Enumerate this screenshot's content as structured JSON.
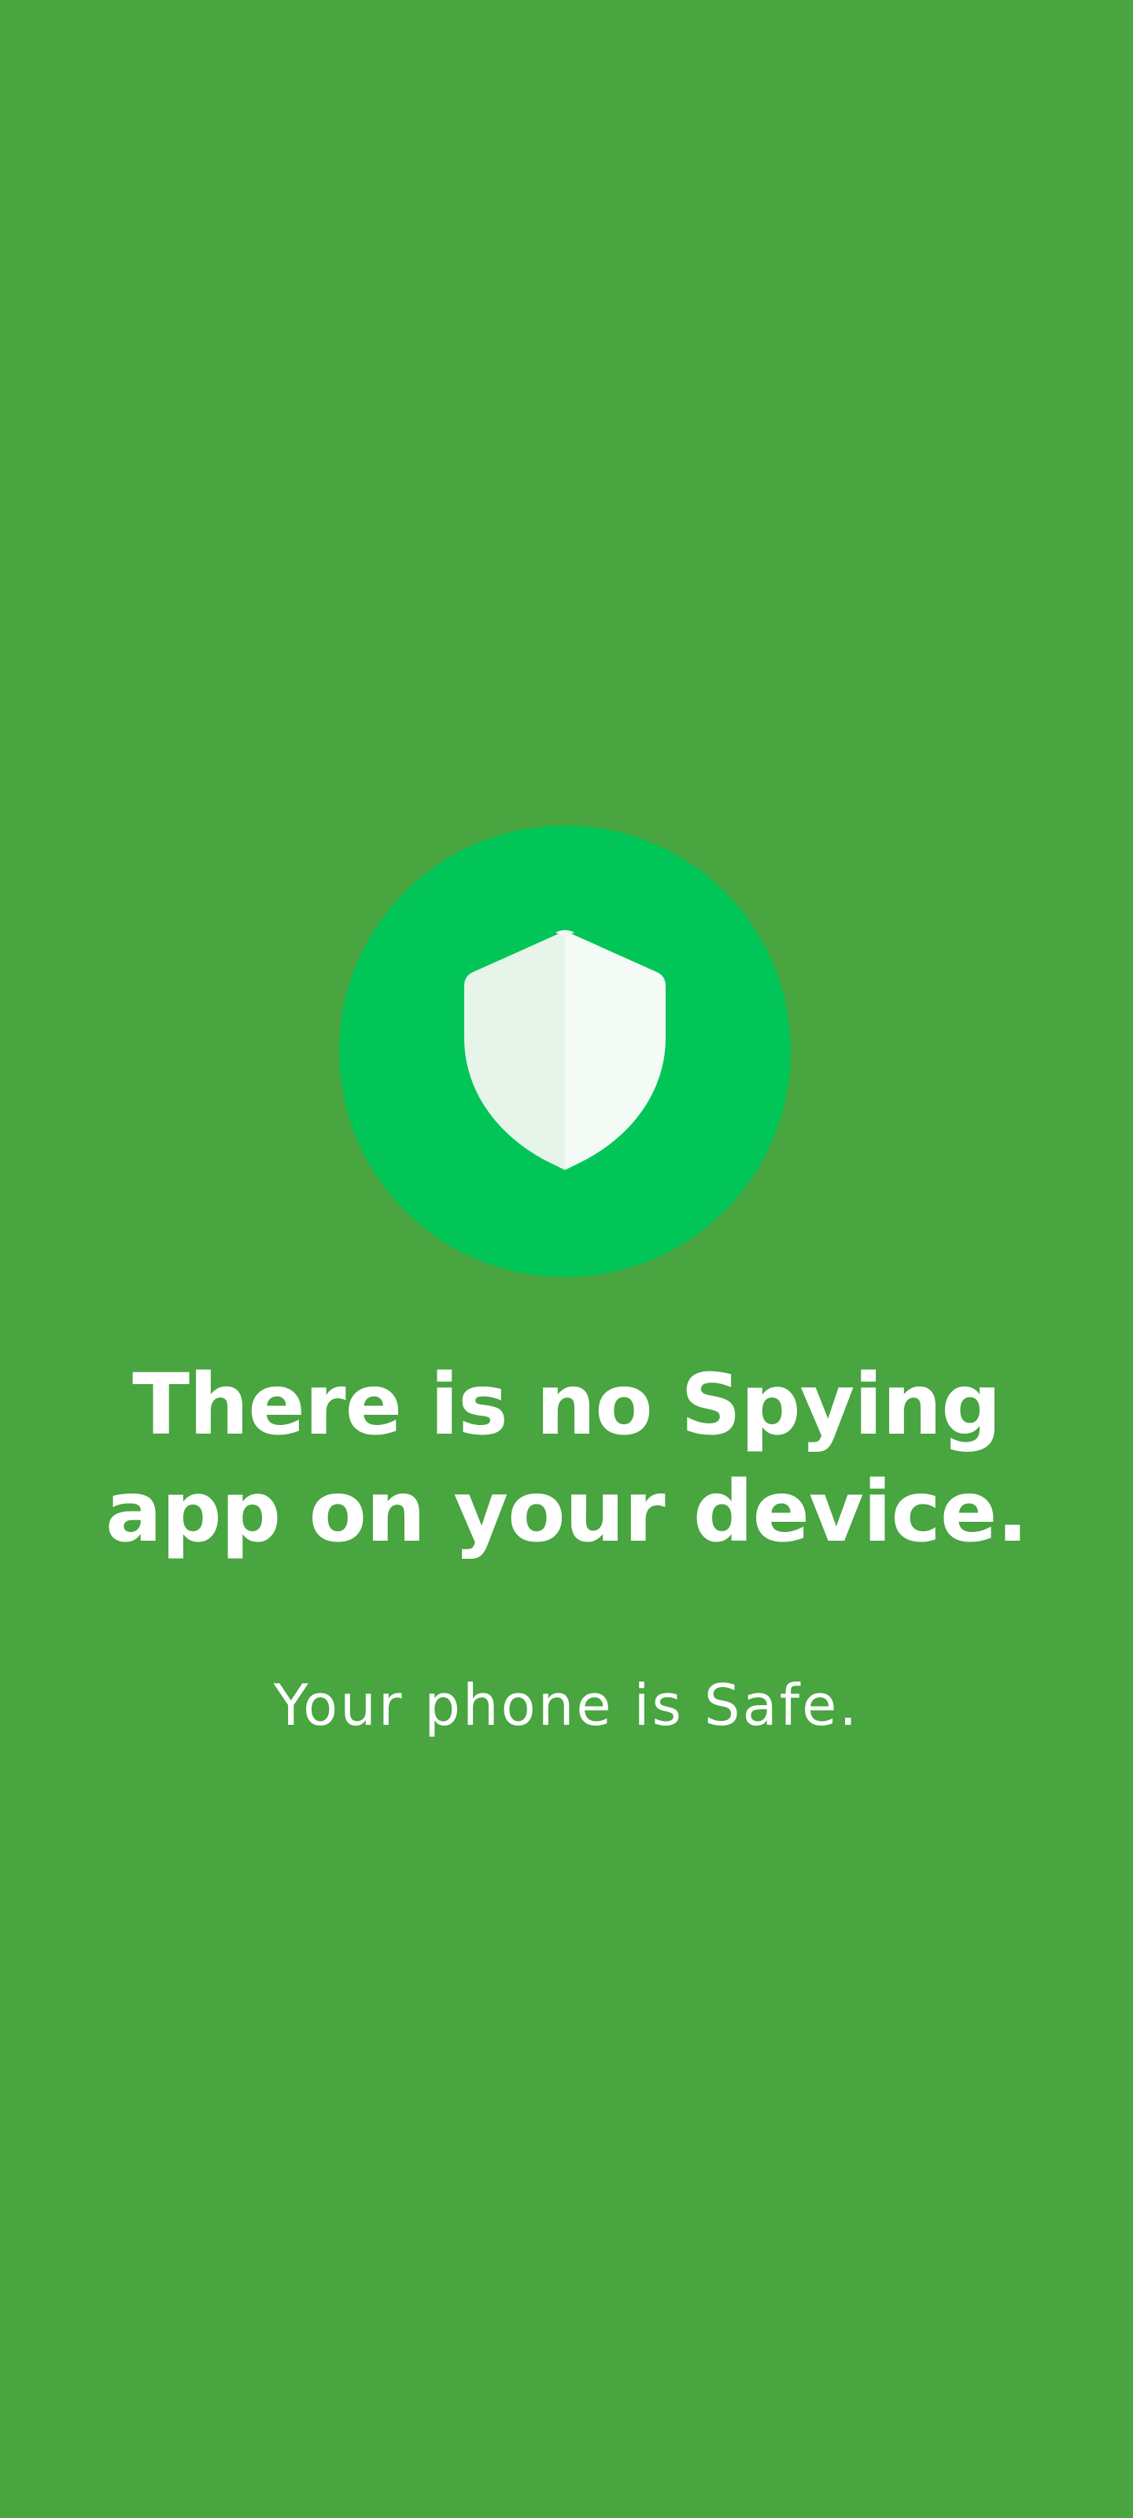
{
  "screen": {
    "background_color": "#48a540",
    "accent_circle_color": "#02c558"
  },
  "status_icon": {
    "name": "shield-icon",
    "state": "safe"
  },
  "result": {
    "headline": "There is no Spying app on your device.",
    "subtext": "Your phone is Safe."
  }
}
